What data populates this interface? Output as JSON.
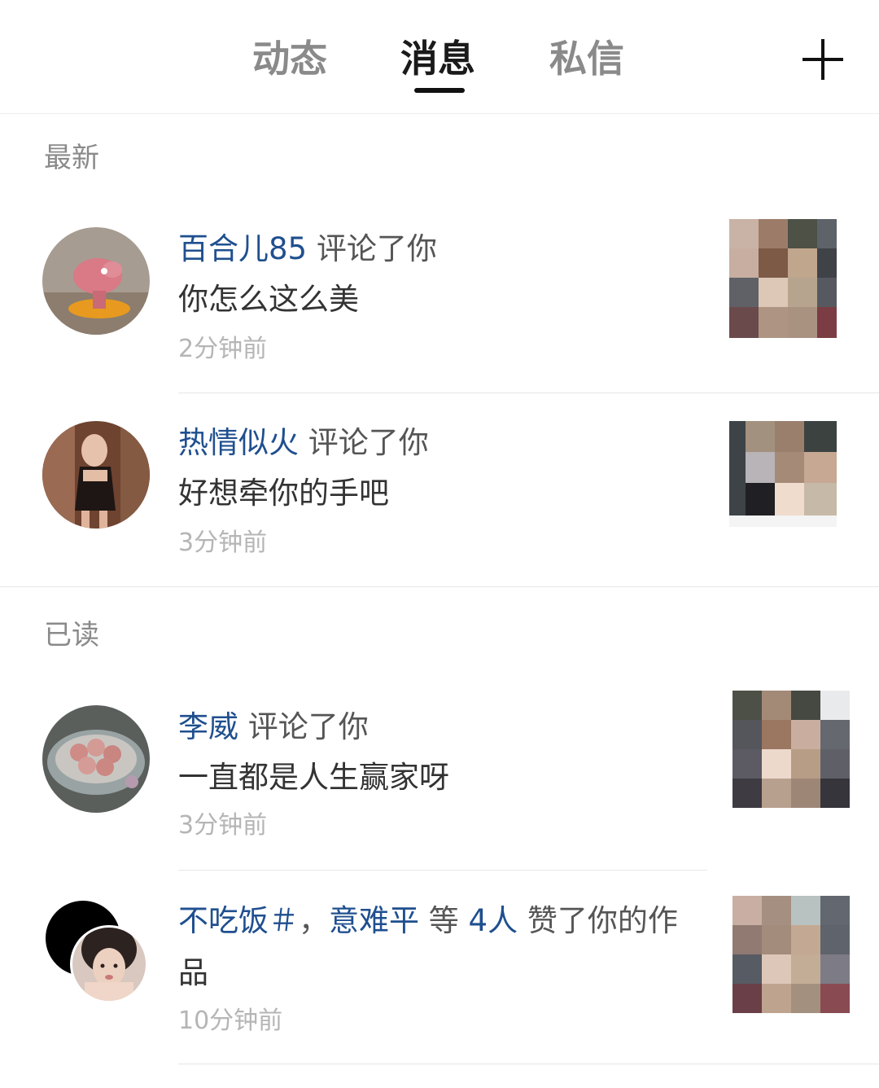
{
  "header": {
    "tabs": [
      {
        "label": "动态",
        "active": false
      },
      {
        "label": "消息",
        "active": true
      },
      {
        "label": "私信",
        "active": false
      }
    ],
    "add_icon": "plus-icon"
  },
  "sections": {
    "latest": "最新",
    "read": "已读"
  },
  "notifications": [
    {
      "user": "百合儿85",
      "action": "评论了你",
      "content": "你怎么这么美",
      "time": "2分钟前"
    },
    {
      "user": "热情似火",
      "action": "评论了你",
      "content": "好想牵你的手吧",
      "time": "3分钟前"
    },
    {
      "user": "李威",
      "action": "评论了你",
      "content": "一直都是人生赢家呀",
      "time": "3分钟前"
    },
    {
      "user_a": "不吃饭＃",
      "separator": "，",
      "user_b": "意难平",
      "mid": "等",
      "count": "4人",
      "action": "赞了你的作",
      "action_cont": "品",
      "time": "10分钟前"
    }
  ],
  "colors": {
    "username": "#1f4f8f",
    "tab_active": "#1a1a1a",
    "tab_inactive": "#8a8a8a",
    "section": "#8a8a8a",
    "time": "#b5b5b5"
  }
}
